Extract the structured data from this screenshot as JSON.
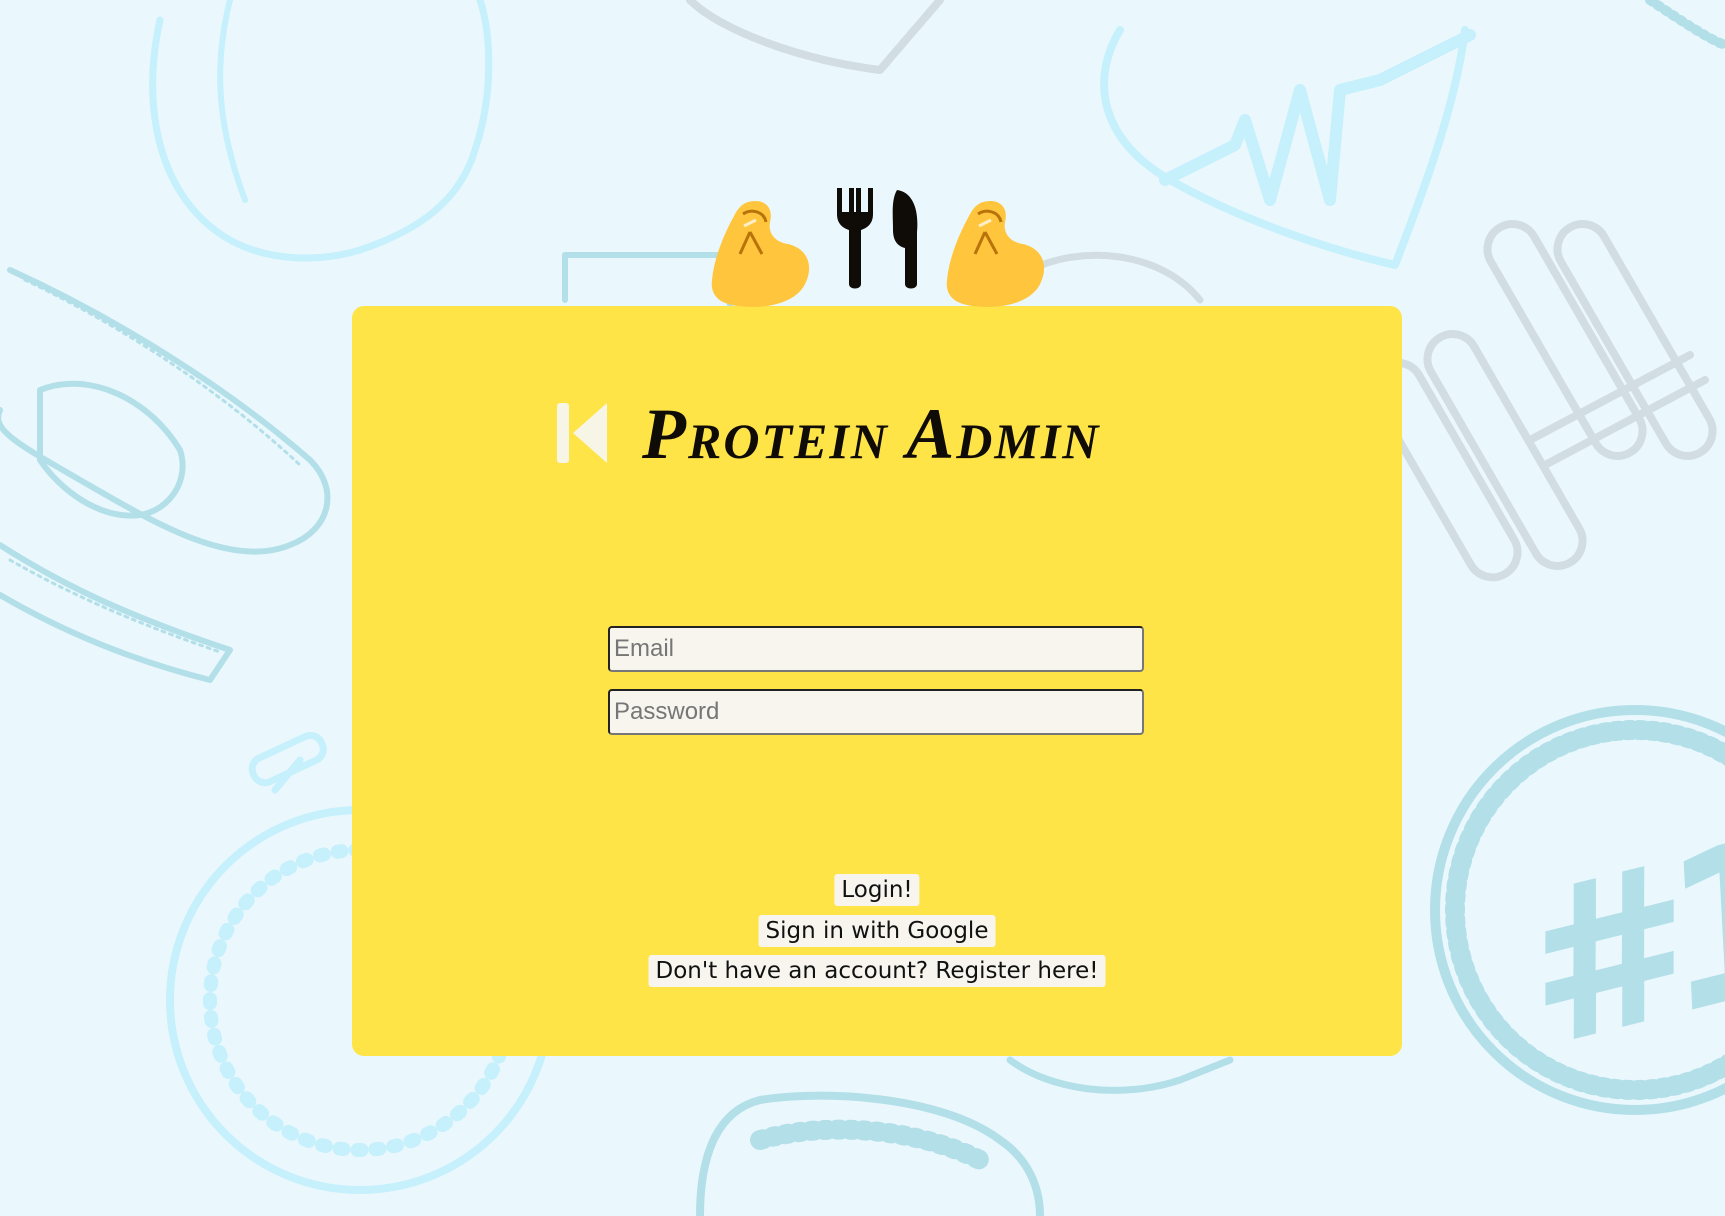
{
  "header": {
    "emojis": [
      "flexed-biceps-icon",
      "fork-and-knife-icon",
      "flexed-biceps-icon"
    ]
  },
  "card": {
    "title": "Protein Admin",
    "back_icon": "skip-back-icon"
  },
  "form": {
    "email_placeholder": "Email",
    "email_value": "",
    "password_placeholder": "Password",
    "password_value": ""
  },
  "actions": {
    "login_label": "Login!",
    "google_label": "Sign in with Google",
    "register_label": "Don't have an account? Register here!"
  },
  "colors": {
    "background": "#eaf8fd",
    "card": "#ffe448",
    "input_bg": "#f7f5ee",
    "doodle_light": "#c6f0fb",
    "doodle_mid": "#b3dfe9",
    "doodle_grey": "#d1dde2"
  }
}
